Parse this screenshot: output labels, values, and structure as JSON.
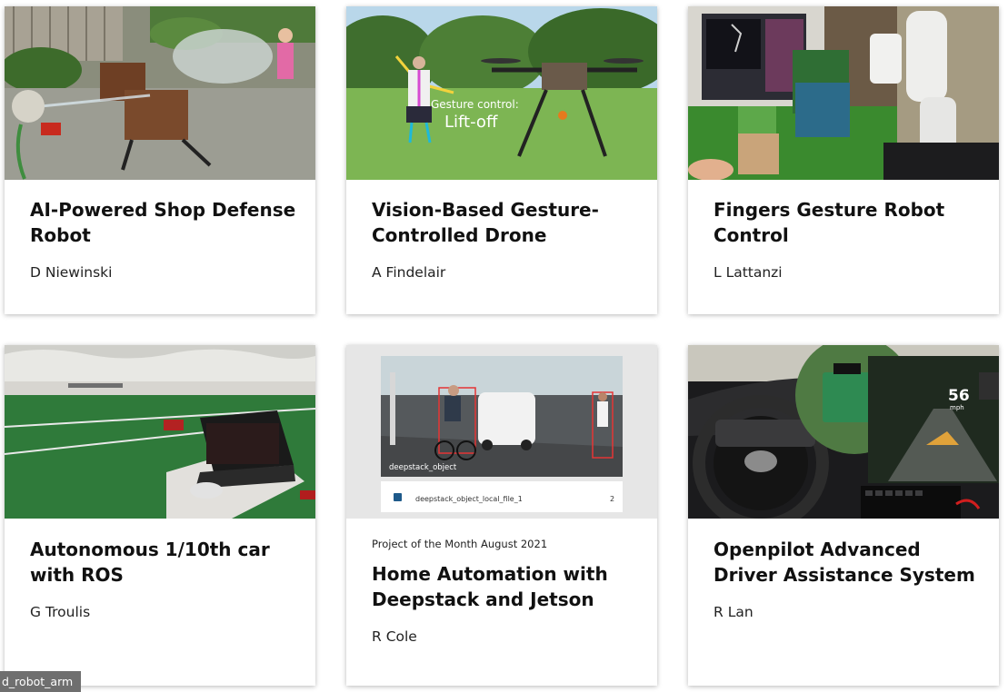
{
  "cards": [
    {
      "title": "AI-Powered Shop Defense Robot",
      "author": "D Niewinski",
      "image": "garden-water-robot-photo"
    },
    {
      "title": "Vision-Based Gesture-Controlled Drone",
      "author": "A Findelair",
      "image": "gesture-drone-photo",
      "image_text": {
        "caption": "Gesture control:",
        "action": "Lift-off"
      }
    },
    {
      "title": "Fingers Gesture Robot Control",
      "author": "L Lattanzi",
      "image": "robot-arm-photo"
    },
    {
      "title": "Autonomous 1/10th car with ROS",
      "author": "G Troulis",
      "image": "rc-car-tent-photo"
    },
    {
      "title": "Home Automation with Deepstack and Jetson",
      "author": "R Cole",
      "kicker": "Project of the Month August 2021",
      "image": "deepstack-detection-screenshot",
      "image_text": {
        "label": "deepstack_object",
        "file": "deepstack_object_local_file_1",
        "count": "2"
      }
    },
    {
      "title": "Openpilot Advanced Driver Assistance System",
      "author": "R Lan",
      "image": "car-dashboard-photo",
      "image_text": {
        "speed": "56",
        "unit": "mph"
      }
    }
  ],
  "tooltip": "d_robot_arm",
  "colors": {
    "title": "#111111",
    "author": "#222222",
    "card_bg": "#ffffff",
    "tooltip_bg": "#6f6f6f"
  }
}
